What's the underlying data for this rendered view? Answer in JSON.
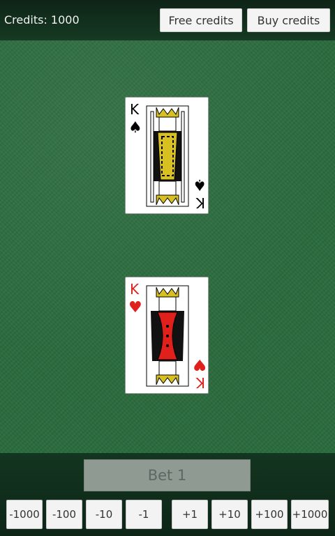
{
  "header": {
    "credits_label": "Credits: 1000",
    "free_credits_label": "Free credits",
    "buy_credits_label": "Buy credits"
  },
  "cards": [
    {
      "rank": "K",
      "suit": "spades",
      "suit_glyph": "♠",
      "color": "#000000"
    },
    {
      "rank": "K",
      "suit": "hearts",
      "suit_glyph": "♥",
      "color": "#e0201a"
    }
  ],
  "bet": {
    "label": "Bet 1"
  },
  "bet_adjust": {
    "buttons": [
      "-1000",
      "-100",
      "-10",
      "-1",
      "+1",
      "+10",
      "+100",
      "+1000"
    ]
  },
  "colors": {
    "felt": "#2a6b3d",
    "king_spades_robe": "#d8c020",
    "king_hearts_robe": "#e0201a"
  }
}
